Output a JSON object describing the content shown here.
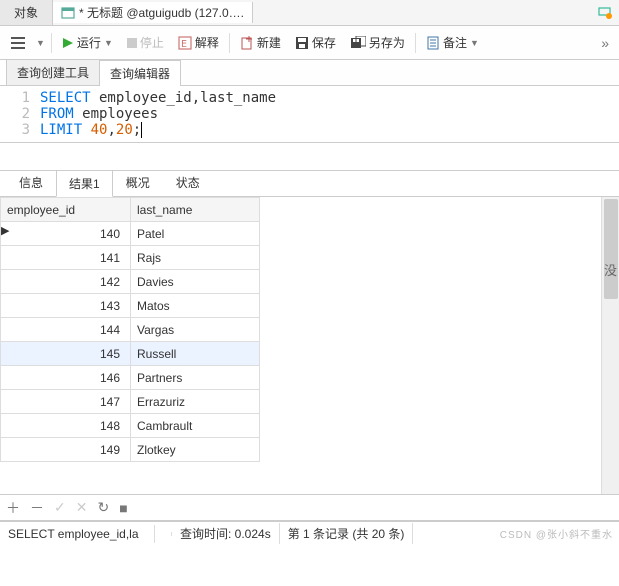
{
  "topTabs": {
    "object": "对象",
    "queryTitle": "* 无标题 @atguigudb (127.0…."
  },
  "toolbar": {
    "run": "运行",
    "stop": "停止",
    "explain": "解释",
    "new": "新建",
    "save": "保存",
    "saveAs": "另存为",
    "note": "备注"
  },
  "subTabs": {
    "builder": "查询创建工具",
    "editor": "查询编辑器"
  },
  "sql": {
    "1": "SELECT employee_id,last_name",
    "2": "FROM employees",
    "3": "LIMIT 40,20;"
  },
  "resultTabs": {
    "info": "信息",
    "r1": "结果1",
    "profile": "概况",
    "status": "状态"
  },
  "grid": {
    "cols": {
      "c1": "employee_id",
      "c2": "last_name"
    },
    "rows": [
      {
        "id": "140",
        "name": "Patel"
      },
      {
        "id": "141",
        "name": "Rajs"
      },
      {
        "id": "142",
        "name": "Davies"
      },
      {
        "id": "143",
        "name": "Matos"
      },
      {
        "id": "144",
        "name": "Vargas"
      },
      {
        "id": "145",
        "name": "Russell"
      },
      {
        "id": "146",
        "name": "Partners"
      },
      {
        "id": "147",
        "name": "Errazuriz"
      },
      {
        "id": "148",
        "name": "Cambrault"
      },
      {
        "id": "149",
        "name": "Zlotkey"
      }
    ]
  },
  "sideText": "没",
  "status": {
    "sql": "SELECT employee_id,la",
    "time": "查询时间: 0.024s",
    "record": "第 1 条记录 (共 20 条)"
  },
  "watermark": "CSDN @张小斜不重水"
}
